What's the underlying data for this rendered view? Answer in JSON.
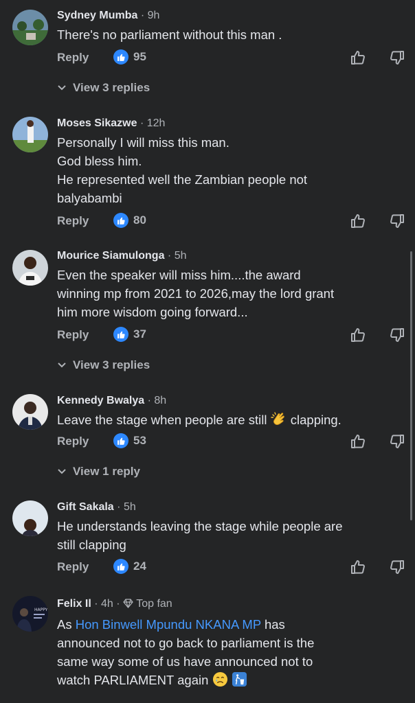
{
  "ui": {
    "reply_label": "Reply",
    "dot": "·"
  },
  "comments": [
    {
      "author": "Sydney Mumba",
      "time": "9h",
      "text": "There's no parliament without this man .",
      "likes": "95",
      "view_replies": "View 3 replies"
    },
    {
      "author": "Moses Sikazwe",
      "time": "12h",
      "lines": [
        "Personally I will miss this man.",
        "God bless him.",
        "He represented well the Zambian people not",
        "balyabambi"
      ],
      "likes": "80"
    },
    {
      "author": "Mourice Siamulonga",
      "time": "5h",
      "lines": [
        "Even the speaker will miss him....the award",
        "winning mp from 2021 to 2026,may the lord grant",
        "him more wisdom going forward..."
      ],
      "likes": "37",
      "view_replies": "View 3 replies"
    },
    {
      "author": "Kennedy Bwalya",
      "time": "8h",
      "text_before_emoji": "Leave the stage when people are still",
      "emoji": "clapping-hands-emoji",
      "text_after_emoji": "clapping.",
      "likes": "53",
      "view_replies": "View 1 reply"
    },
    {
      "author": "Gift Sakala",
      "time": "5h",
      "lines": [
        "He understands leaving the stage while people are",
        "still clapping"
      ],
      "likes": "24"
    },
    {
      "author": "Felix Il",
      "time": "4h",
      "badge_icon": "diamond-icon",
      "badge": "Top fan",
      "prefix": "As ",
      "mention": "Hon Binwell Mpundu NKANA MP",
      "line1_rest": " has",
      "lines": [
        "announced not to go back to parliament is the",
        "same way some of us have announced not to"
      ],
      "last_line": "watch PARLIAMENT again",
      "end_emojis": [
        "crying-face-emoji",
        "litter-bin-emoji"
      ],
      "avatar_text": "HAPPY"
    }
  ],
  "colors": {
    "background": "#242526",
    "text": "#e4e6eb",
    "secondary": "#b0b3b8",
    "link": "#4599ff",
    "like_badge": "#2d88ff"
  }
}
